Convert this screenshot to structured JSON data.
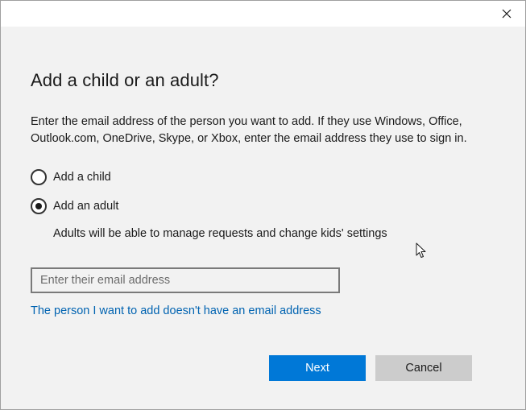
{
  "dialog": {
    "title": "Add a child or an adult?",
    "description": "Enter the email address of the person you want to add. If they use Windows, Office, Outlook.com, OneDrive, Skype, or Xbox, enter the email address they use to sign in.",
    "options": [
      {
        "label": "Add a child",
        "selected": false
      },
      {
        "label": "Add an adult",
        "selected": true
      }
    ],
    "adult_note": "Adults will be able to manage requests and change kids' settings",
    "email": {
      "value": "",
      "placeholder": "Enter their email address"
    },
    "no_email_link": "The person I want to add doesn't have an email address",
    "buttons": {
      "next": "Next",
      "cancel": "Cancel"
    }
  },
  "icons": {
    "close": "close-icon",
    "cursor": "mouse-pointer-icon"
  },
  "colors": {
    "accent": "#0078d7",
    "link": "#0063b1",
    "background": "#f2f2f2",
    "cancel_button": "#cccccc"
  }
}
